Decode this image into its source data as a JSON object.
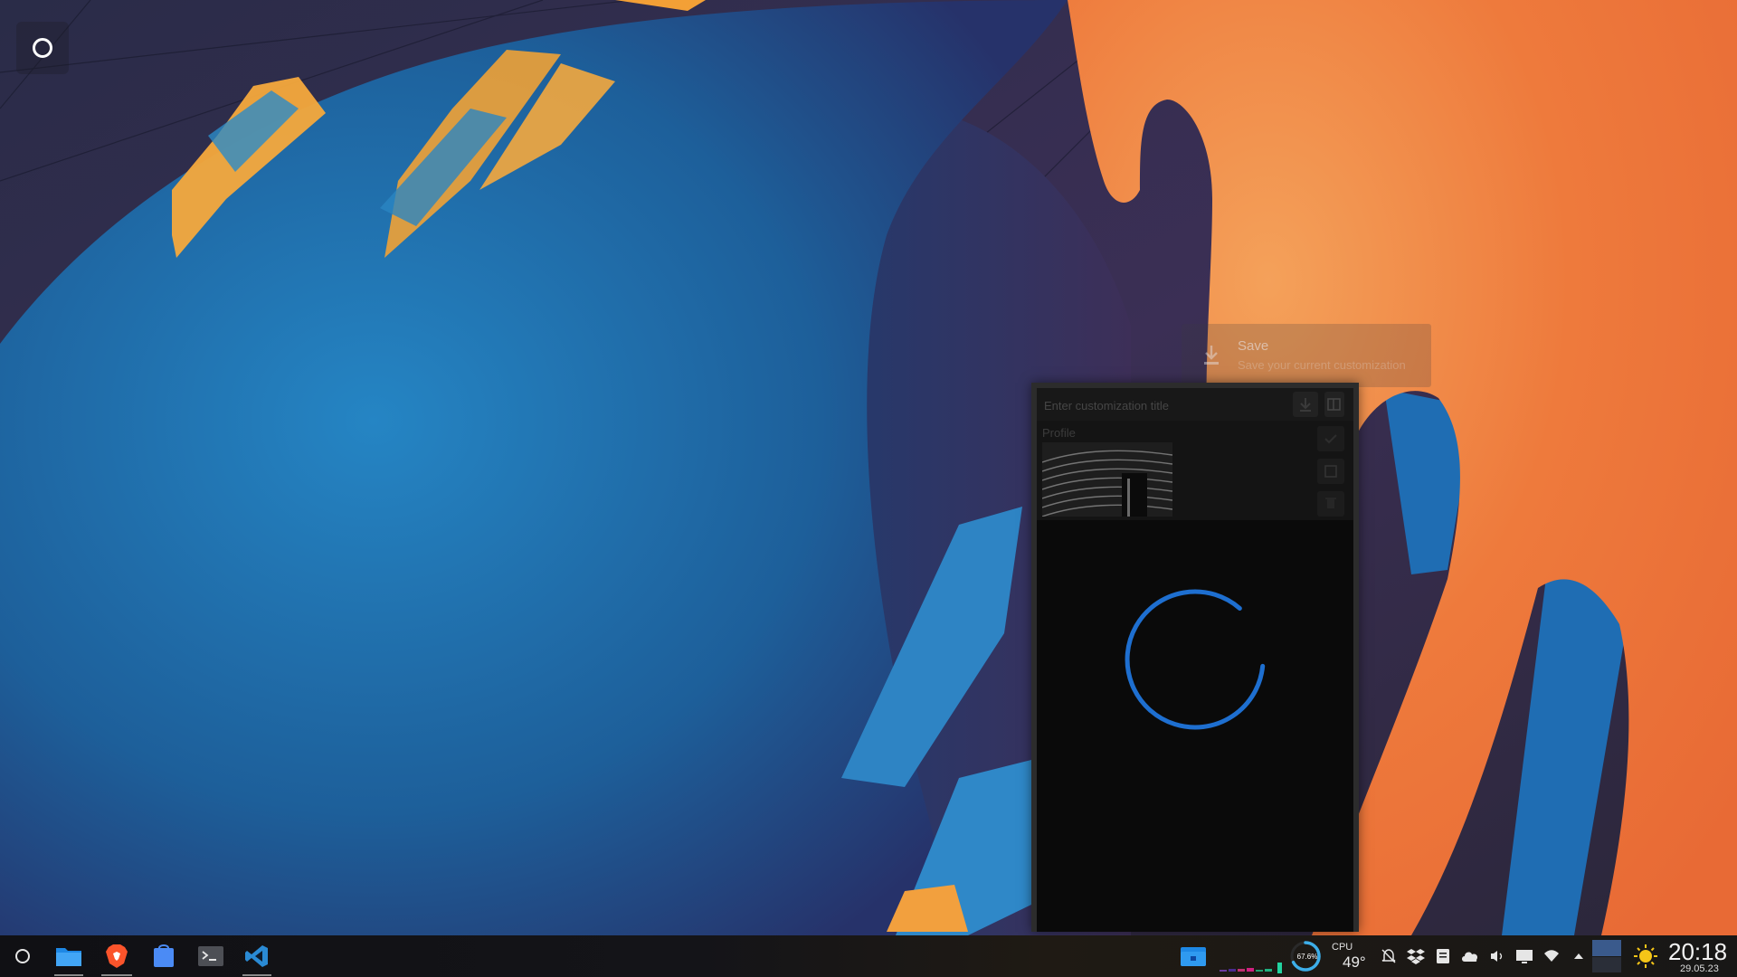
{
  "tooltip": {
    "title": "Save",
    "subtitle": "Save your current customization",
    "icon": "download-icon"
  },
  "popup": {
    "title_placeholder": "Enter customization title",
    "profile_label": "Profile",
    "header_buttons": [
      "download-icon",
      "open-icon"
    ],
    "profile_buttons": [
      "check-icon",
      "edit-icon",
      "trash-icon"
    ],
    "state": "loading"
  },
  "taskbar": {
    "apps": [
      {
        "name": "Application Launcher",
        "icon": "launcher-icon",
        "active": false
      },
      {
        "name": "Dolphin",
        "icon": "folder-icon",
        "active": true
      },
      {
        "name": "Brave",
        "icon": "brave-icon",
        "active": true
      },
      {
        "name": "Discover",
        "icon": "store-icon",
        "active": false
      },
      {
        "name": "Konsole",
        "icon": "terminal-icon",
        "active": false
      },
      {
        "name": "Visual Studio Code",
        "icon": "vscode-icon",
        "active": true
      }
    ],
    "gauge_value": "67.6%",
    "gauge_fraction": 0.676,
    "cpu_label": "CPU",
    "cpu_temp": "49°",
    "tray_icons": [
      "notifications-disabled-icon",
      "dropbox-icon",
      "clipboard-icon",
      "cloud-icon",
      "volume-icon",
      "display-icon",
      "wifi-icon",
      "expand-arrow-icon"
    ],
    "weather_icon": "sun-icon",
    "clock": {
      "time": "20:18",
      "date": "29.05.23"
    }
  },
  "colors": {
    "accent": "#3daee9",
    "spinner": "#1e6fd0",
    "wallpaper_blue": "#1f6fae",
    "wallpaper_orange": "#f07a3a"
  }
}
